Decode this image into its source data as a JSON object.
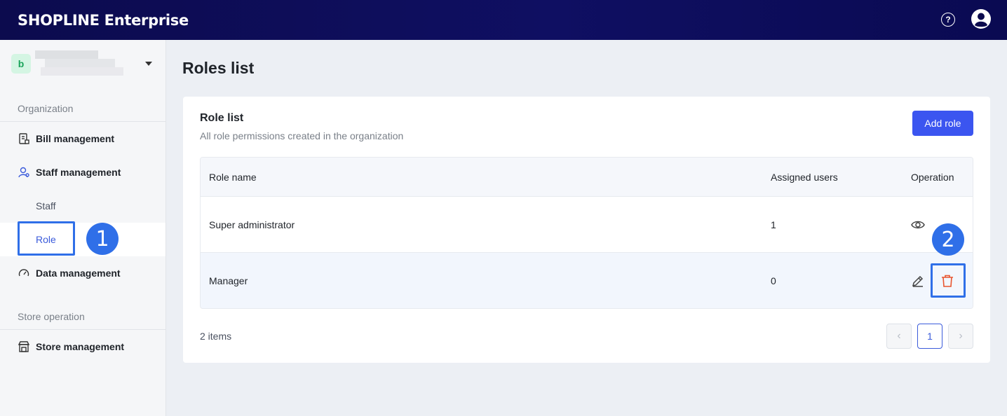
{
  "header": {
    "logo_text": "SHOPLINE Enterprise",
    "help_icon": "help-circle-icon",
    "help_glyph": "?",
    "avatar_icon": "user-avatar-icon"
  },
  "sidebar": {
    "org_badge": "b",
    "sections": [
      {
        "label": "Organization"
      },
      {
        "label": "Store operation"
      }
    ],
    "items": [
      {
        "label": "Bill management",
        "icon": "bill-icon"
      },
      {
        "label": "Staff management",
        "icon": "staff-icon"
      },
      {
        "label": "Staff"
      },
      {
        "label": "Role"
      },
      {
        "label": "Data management",
        "icon": "gauge-icon"
      },
      {
        "label": "Store management",
        "icon": "store-icon"
      }
    ],
    "callout_1": "1"
  },
  "main": {
    "page_title": "Roles list",
    "card_title": "Role list",
    "card_subtitle": "All role permissions created in the organization",
    "add_button": "Add role",
    "table": {
      "columns": [
        "Role name",
        "Assigned users",
        "Operation"
      ],
      "rows": [
        {
          "name": "Super administrator",
          "users": "1",
          "operations": [
            "view-icon"
          ]
        },
        {
          "name": "Manager",
          "users": "0",
          "operations": [
            "edit-icon",
            "delete-icon"
          ]
        }
      ]
    },
    "callout_2": "2",
    "items_count": "2 items",
    "pagination": {
      "prev": "‹",
      "current": "1",
      "next": "›"
    }
  },
  "colors": {
    "header_bg": "#0c0b4e",
    "accent": "#3b55f0",
    "callout": "#2f6fe8",
    "delete": "#e8542e"
  }
}
